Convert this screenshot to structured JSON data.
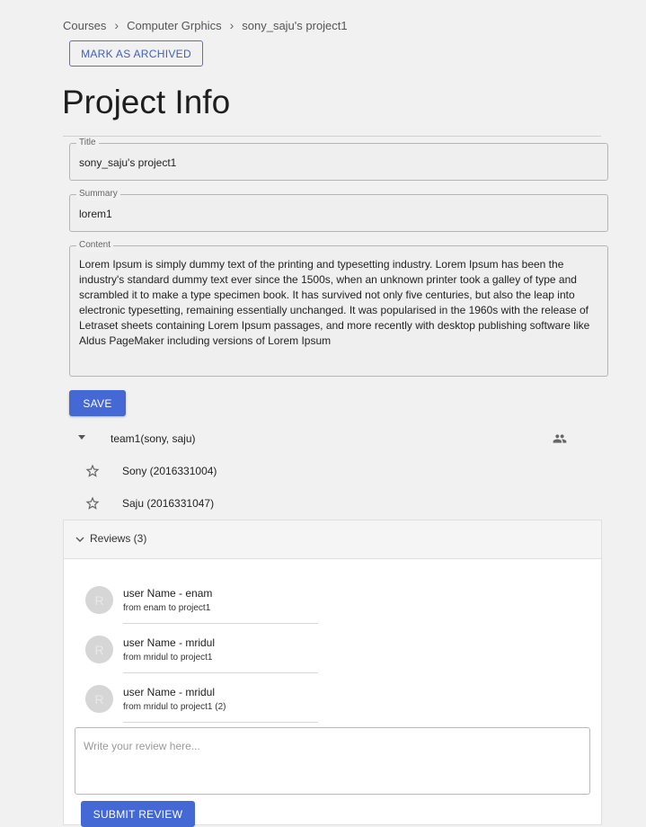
{
  "breadcrumb": {
    "items": [
      "Courses",
      "Computer Grphics",
      "sony_saju's project1"
    ]
  },
  "archive_button": "MARK AS ARCHIVED",
  "page_title": "Project Info",
  "form": {
    "title": {
      "label": "Title",
      "value": "sony_saju's project1"
    },
    "summary": {
      "label": "Summary",
      "value": "lorem1"
    },
    "content": {
      "label": "Content",
      "value": "Lorem Ipsum is simply dummy text of the printing and typesetting industry. Lorem Ipsum has been the industry's standard dummy text ever since the 1500s, when an unknown printer took a galley of type and scrambled it to make a type specimen book. It has survived not only five centuries, but also the leap into electronic typesetting, remaining essentially unchanged. It was popularised in the 1960s with the release of Letraset sheets containing Lorem Ipsum passages, and more recently with desktop publishing software like Aldus PageMaker including versions of Lorem Ipsum"
    },
    "save_label": "SAVE"
  },
  "team": {
    "label": "team1(sony, saju)",
    "members": [
      {
        "label": "Sony (2016331004)"
      },
      {
        "label": "Saju (2016331047)"
      }
    ]
  },
  "reviews": {
    "header": "Reviews (3)",
    "items": [
      {
        "avatar": "R",
        "name": "user Name - enam",
        "text": "from enam to project1"
      },
      {
        "avatar": "R",
        "name": "user Name - mridul",
        "text": "from mridul to project1"
      },
      {
        "avatar": "R",
        "name": "user Name - mridul",
        "text": "from mridul to project1 (2)"
      }
    ],
    "input_placeholder": "Write your review here...",
    "submit_label": "SUBMIT REVIEW"
  },
  "colors": {
    "accent": "#4468d4",
    "background": "#f1f1f1"
  }
}
